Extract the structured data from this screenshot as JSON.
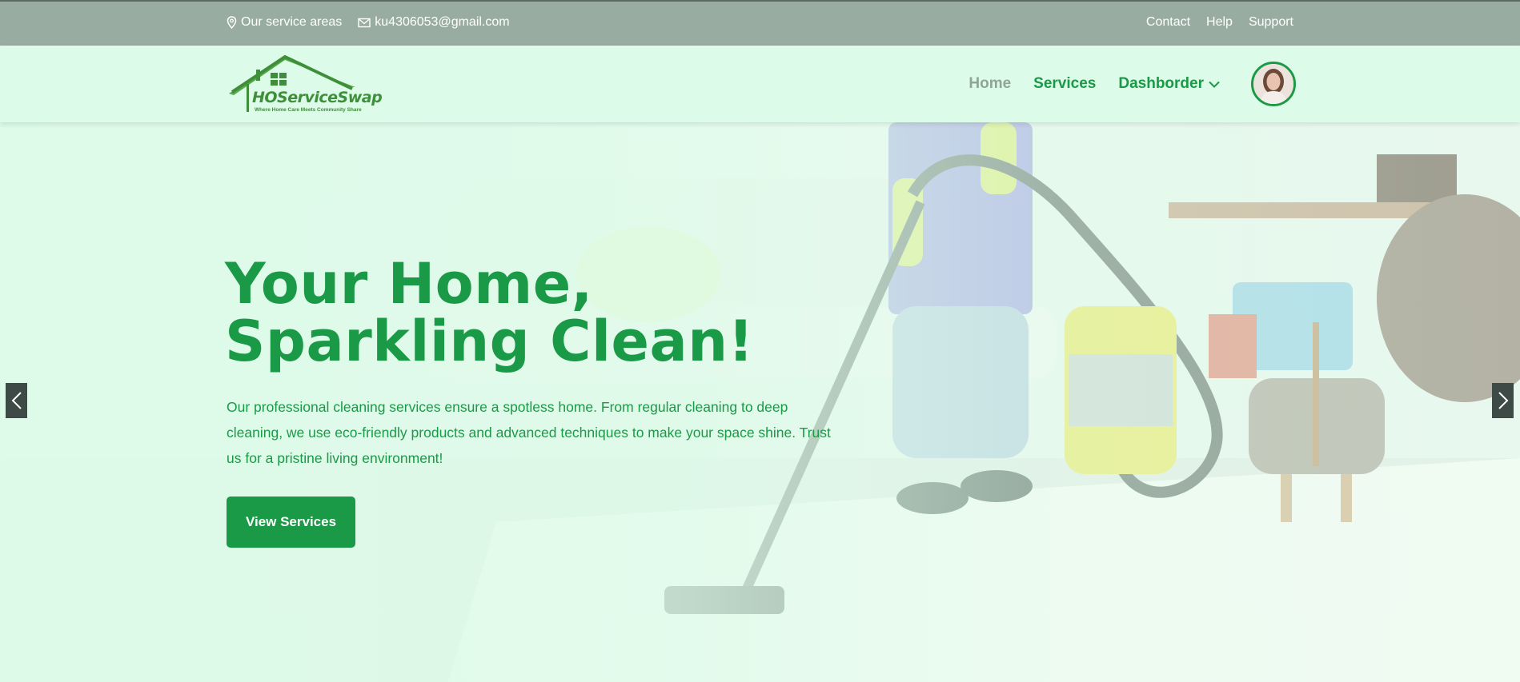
{
  "topbar": {
    "service_areas": "Our service areas",
    "email": "ku4306053@gmail.com",
    "links": {
      "contact": "Contact",
      "help": "Help",
      "support": "Support"
    }
  },
  "header": {
    "logo": {
      "brand": "HOServiceSwap",
      "tagline": "Where Home Care Meets Community Share"
    },
    "nav": {
      "home": "Home",
      "services": "Services",
      "dashboard": "Dashborder"
    }
  },
  "hero": {
    "title_line1": "Your Home,",
    "title_line2": "Sparkling Clean!",
    "description": "Our professional cleaning services ensure a spotless home. From regular cleaning to deep cleaning, we use eco-friendly products and advanced techniques to make your space shine. Trust us for a pristine living environment!",
    "cta_label": "View Services"
  },
  "colors": {
    "primary_green": "#1a9a46",
    "topbar_bg": "#99aca2",
    "header_bg": "#dcfbe8",
    "nav_inactive": "#8fa596"
  },
  "icons": {
    "location": "location-pin-icon",
    "email": "envelope-icon",
    "dropdown": "chevron-down-icon",
    "prev": "chevron-left-icon",
    "next": "chevron-right-icon"
  }
}
